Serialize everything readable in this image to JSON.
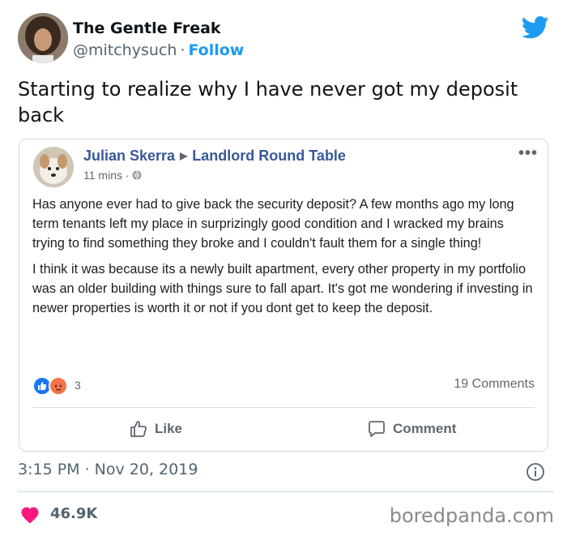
{
  "tweet": {
    "author_name": "The Gentle Freak",
    "handle": "@mitchysuch",
    "separator": "·",
    "follow_label": "Follow",
    "text": "Starting to realize why I have never got my deposit back",
    "timestamp": "3:15 PM · Nov 20, 2019",
    "likes": "46.9K"
  },
  "fb_post": {
    "author": "Julian Skerra",
    "group": "Landlord Round Table",
    "time": "11 mins ·",
    "paragraph_1": "Has anyone ever had to give back the security deposit? A few months ago my long term tenants left my place in surprizingly good condition and I wracked my brains trying to find something they broke and I couldn't fault them for a single thing!",
    "paragraph_2": "I think it was because its a newly built apartment, every other property in my portfolio was an older building with things sure to fall apart. It's got me wondering if investing in newer properties is worth it or not if you dont get to keep the deposit.",
    "reaction_count": "3",
    "comments_count": "19 Comments",
    "like_label": "Like",
    "comment_label": "Comment"
  },
  "watermark": "boredpanda.com",
  "colors": {
    "twitter_blue": "#1d9bf0",
    "fb_link": "#385898",
    "heart": "#f91880"
  }
}
